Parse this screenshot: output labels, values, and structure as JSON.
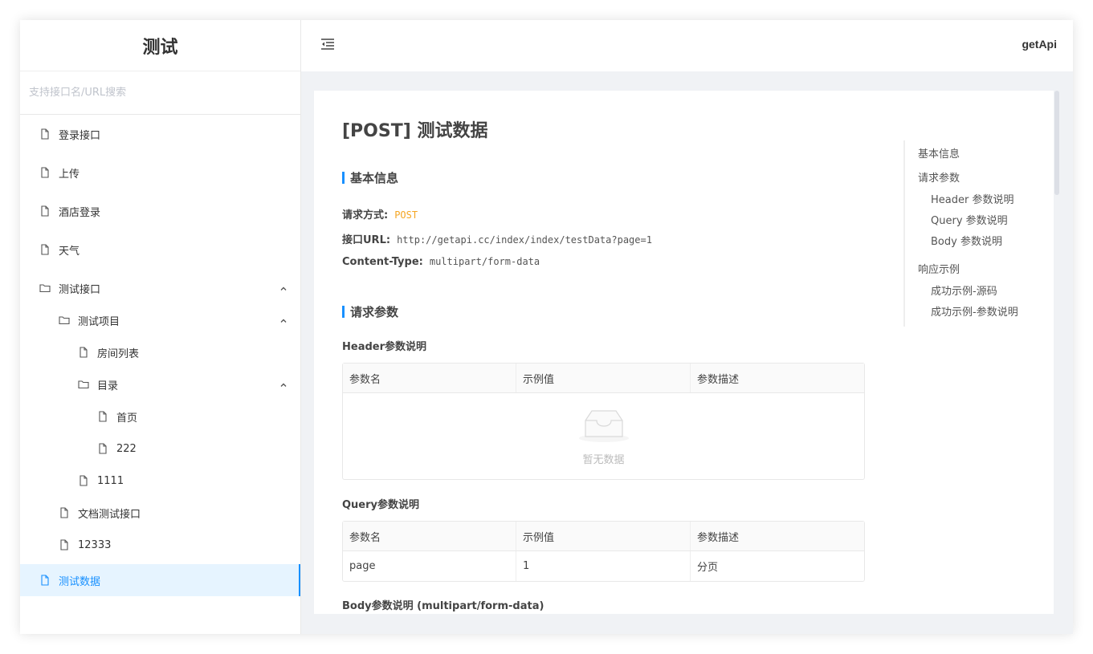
{
  "sidebar": {
    "brand": "测试",
    "search_placeholder": "支持接口名/URL搜索",
    "items": [
      {
        "label": "登录接口",
        "type": "file"
      },
      {
        "label": "上传",
        "type": "file"
      },
      {
        "label": "酒店登录",
        "type": "file"
      },
      {
        "label": "天气",
        "type": "file"
      },
      {
        "label": "测试接口",
        "type": "folder"
      },
      {
        "label": "测试项目",
        "type": "folder"
      },
      {
        "label": "房间列表",
        "type": "file"
      },
      {
        "label": "目录",
        "type": "folder"
      },
      {
        "label": "首页",
        "type": "file"
      },
      {
        "label": "222",
        "type": "file"
      },
      {
        "label": "1111",
        "type": "file"
      },
      {
        "label": "文档测试接口",
        "type": "file"
      },
      {
        "label": "12333",
        "type": "file"
      },
      {
        "label": "测试数据",
        "type": "file",
        "active": true
      }
    ]
  },
  "header": {
    "user": "getApi"
  },
  "doc": {
    "title": "[POST] 测试数据",
    "basic_section": "基本信息",
    "method_label": "请求方式:",
    "method_value": "POST",
    "url_label": "接口URL:",
    "url_value": "http://getapi.cc/index/index/testData?page=1",
    "ctype_label": "Content-Type:",
    "ctype_value": "multipart/form-data",
    "params_section": "请求参数",
    "header_title": "Header参数说明",
    "query_title": "Query参数说明",
    "body_title": "Body参数说明 (multipart/form-data)",
    "columns": [
      "参数名",
      "示例值",
      "参数描述"
    ],
    "empty_text": "暂无数据",
    "query_rows": [
      [
        "page",
        "1",
        "分页"
      ]
    ]
  },
  "toc": {
    "items": [
      "基本信息",
      "请求参数",
      "Header 参数说明",
      "Query 参数说明",
      "Body 参数说明",
      "响应示例",
      "成功示例-源码",
      "成功示例-参数说明"
    ]
  },
  "colors": {
    "accent": "#1890ff",
    "method": "#f5a623",
    "active_bg": "#e6f4ff"
  }
}
